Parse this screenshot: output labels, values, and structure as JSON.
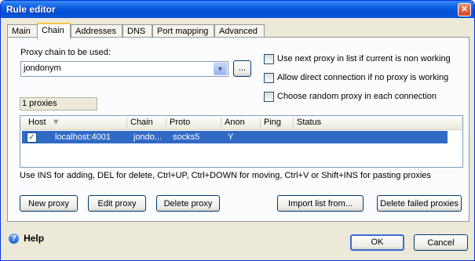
{
  "window": {
    "title": "Rule editor",
    "close_glyph": "✕"
  },
  "tabs": [
    "Main",
    "Chain",
    "Addresses",
    "DNS",
    "Port mapping",
    "Advanced"
  ],
  "chain": {
    "proxy_chain_label": "Proxy chain to be used:",
    "proxy_chain_value": "jondonym",
    "browse_label": "...",
    "proxy_count": "1 proxies",
    "options": [
      "Use next proxy in list if current is non working",
      "Allow direct connection if no proxy is working",
      "Choose random proxy in each connection"
    ],
    "columns": [
      "Host",
      "Chain",
      "Proto",
      "Anon",
      "Ping",
      "Status"
    ],
    "rows": [
      {
        "host": "localhost:4001",
        "chain": "jondo...",
        "proto": "socks5",
        "anon": "Y",
        "ping": "",
        "status": ""
      }
    ],
    "hint": "Use INS for adding, DEL for delete, Ctrl+UP, Ctrl+DOWN for moving, Ctrl+V or Shift+INS for pasting proxies",
    "buttons": {
      "new": "New proxy",
      "edit": "Edit proxy",
      "delete": "Delete proxy",
      "import": "Import list from...",
      "delete_failed": "Delete failed proxies"
    }
  },
  "footer": {
    "help": "Help",
    "ok": "OK",
    "cancel": "Cancel"
  }
}
